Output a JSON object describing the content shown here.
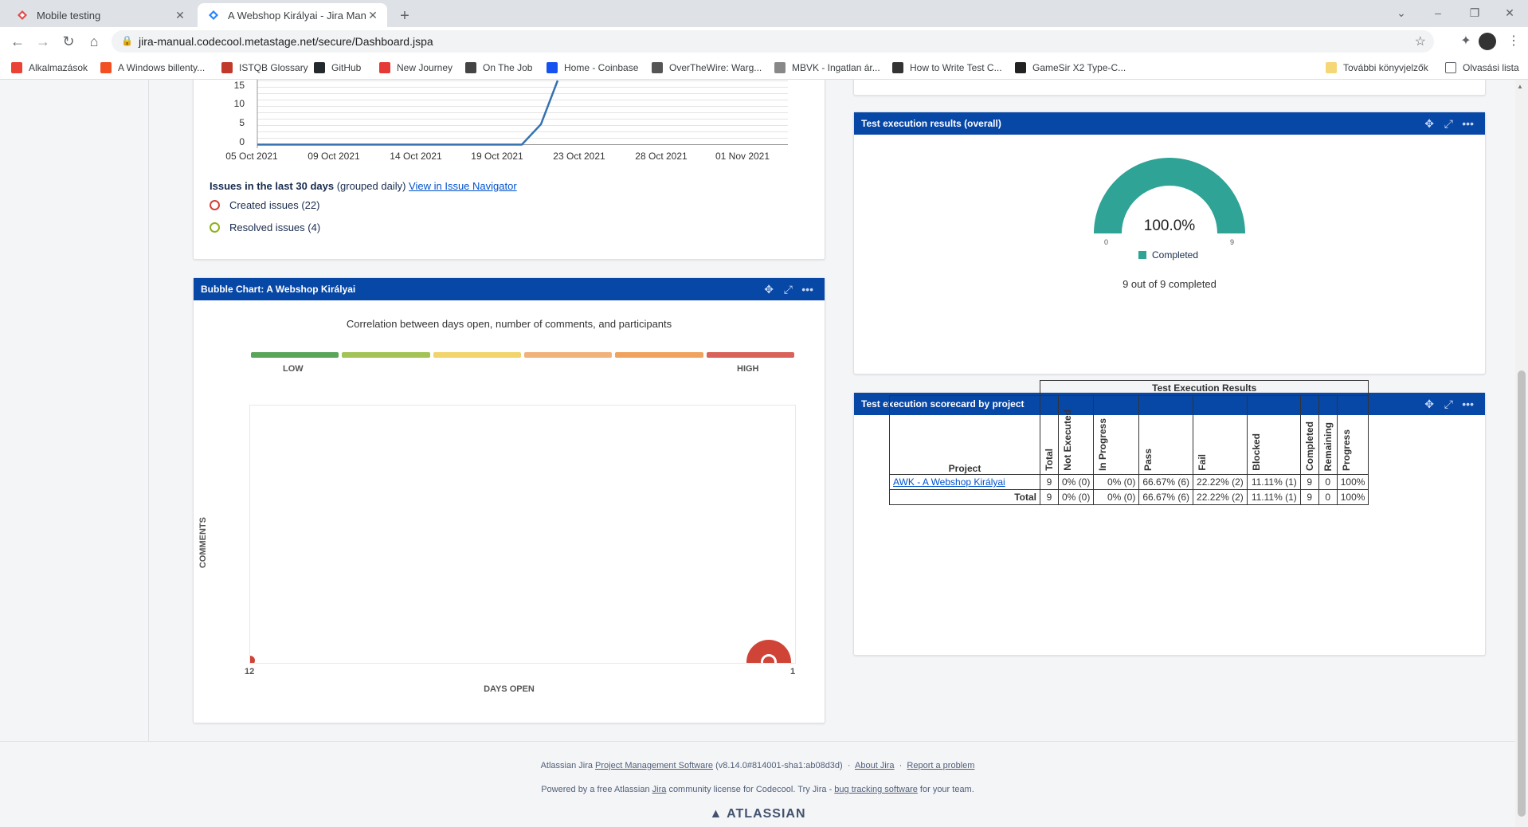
{
  "browser": {
    "tabs": [
      {
        "title": "Mobile testing"
      },
      {
        "title": "A Webshop Királyai - Jira Manual"
      }
    ],
    "url": "jira-manual.codecool.metastage.net/secure/Dashboard.jspa",
    "bookmarks": [
      {
        "label": "Alkalmazások",
        "color": "#ea4335"
      },
      {
        "label": "A Windows billenty...",
        "color": "#f25022"
      },
      {
        "label": "ISTQB Glossary",
        "color": "#c0392b"
      },
      {
        "label": "GitHub",
        "color": "#24292e"
      },
      {
        "label": "New Journey",
        "color": "#e53935"
      },
      {
        "label": "On The Job",
        "color": "#444444"
      },
      {
        "label": "Home - Coinbase",
        "color": "#1652f0"
      },
      {
        "label": "OverTheWire: Warg...",
        "color": "#555555"
      },
      {
        "label": "MBVK - Ingatlan ár...",
        "color": "#888888"
      },
      {
        "label": "How to Write Test C...",
        "color": "#333333"
      },
      {
        "label": "GameSir X2 Type-C...",
        "color": "#222222"
      }
    ],
    "other_bookmarks": "További könyvjelzők",
    "reading_list": "Olvasási lista"
  },
  "issues_chart": {
    "y_ticks": [
      "15",
      "10",
      "5",
      "0"
    ],
    "x_ticks": [
      "05 Oct 2021",
      "09 Oct 2021",
      "14 Oct 2021",
      "19 Oct 2021",
      "23 Oct 2021",
      "28 Oct 2021",
      "01 Nov 2021"
    ],
    "caption_bold": "Issues in the last 30 days",
    "caption_rest": "(grouped daily)",
    "caption_link": "View in Issue Navigator",
    "legend": [
      {
        "label": "Created issues (22)",
        "color": "#d04437"
      },
      {
        "label": "Resolved issues (4)",
        "color": "#8eb021"
      }
    ]
  },
  "bubble_chart": {
    "title": "Bubble Chart: A Webshop Királyai",
    "subtitle": "Correlation between days open, number of comments, and participants",
    "scale_colors": [
      "#59a559",
      "#a3c356",
      "#f1d46b",
      "#f2b27b",
      "#f0a35e",
      "#d9625a"
    ],
    "low_label": "LOW",
    "high_label": "HIGH",
    "y_axis_label": "COMMENTS",
    "x_axis_label": "DAYS OPEN",
    "x_left": "12",
    "x_right": "1"
  },
  "test_overall": {
    "title": "Test execution results (overall)",
    "percent": "100.0%",
    "min": "0",
    "max": "9",
    "legend": "Completed",
    "color": "#2ea396",
    "summary": "9 out of 9 completed"
  },
  "scorecard": {
    "title": "Test execution scorecard by project",
    "group_header": "Test Execution Results",
    "project_header": "Project",
    "columns": [
      "Total",
      "Not Executed",
      "In Progress",
      "Pass",
      "Fail",
      "Blocked",
      "Completed",
      "Remaining",
      "Progress"
    ],
    "rows": [
      {
        "project": "AWK - A Webshop Királyai",
        "cells": [
          "9",
          "0% (0)",
          "0% (0)",
          "66.67% (6)",
          "22.22% (2)",
          "11.11% (1)",
          "9",
          "0",
          "100%"
        ]
      }
    ],
    "total": {
      "label": "Total",
      "cells": [
        "9",
        "0% (0)",
        "0% (0)",
        "66.67% (6)",
        "22.22% (2)",
        "11.11% (1)",
        "9",
        "0",
        "100%"
      ]
    }
  },
  "footer": {
    "line1_prefix": "Atlassian Jira",
    "line1_link": "Project Management Software",
    "line1_version": "(v8.14.0#814001-sha1:ab08d3d)",
    "about": "About Jira",
    "report": "Report a problem",
    "line2_a": "Powered by a free Atlassian",
    "line2_jira": "Jira",
    "line2_b": "community license for Codecool. Try Jira -",
    "line2_link": "bug tracking software",
    "line2_c": "for your team.",
    "brand": "ATLASSIAN"
  }
}
